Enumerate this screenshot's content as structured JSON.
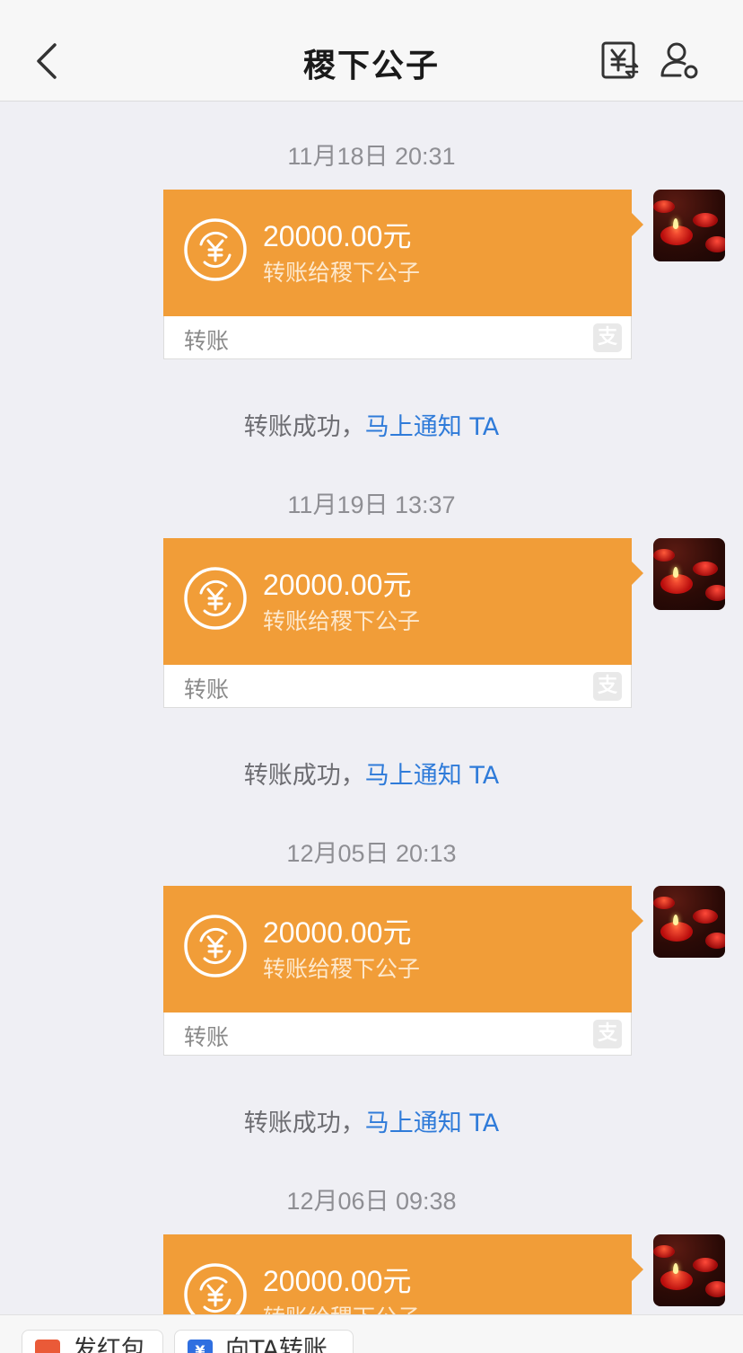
{
  "header": {
    "title": "稷下公子"
  },
  "messages": [
    {
      "timestamp": "11月18日 20:31",
      "amount": "20000.00元",
      "description": "转账给稷下公子",
      "card_label": "转账",
      "notice_text": "转账成功，",
      "notice_link": "马上通知 TA"
    },
    {
      "timestamp": "11月19日 13:37",
      "amount": "20000.00元",
      "description": "转账给稷下公子",
      "card_label": "转账",
      "notice_text": "转账成功，",
      "notice_link": "马上通知 TA"
    },
    {
      "timestamp": "12月05日 20:13",
      "amount": "20000.00元",
      "description": "转账给稷下公子",
      "card_label": "转账",
      "notice_text": "转账成功，",
      "notice_link": "马上通知 TA"
    },
    {
      "timestamp": "12月06日 09:38",
      "amount": "20000.00元",
      "description": "转账给稷下公子"
    }
  ],
  "bottom_bar": {
    "red_packet_label": "发红包",
    "transfer_label": "向TA转账"
  },
  "colors": {
    "card_orange": "#f19d38",
    "link_blue": "#2f7bd9",
    "background": "#efeff4"
  }
}
